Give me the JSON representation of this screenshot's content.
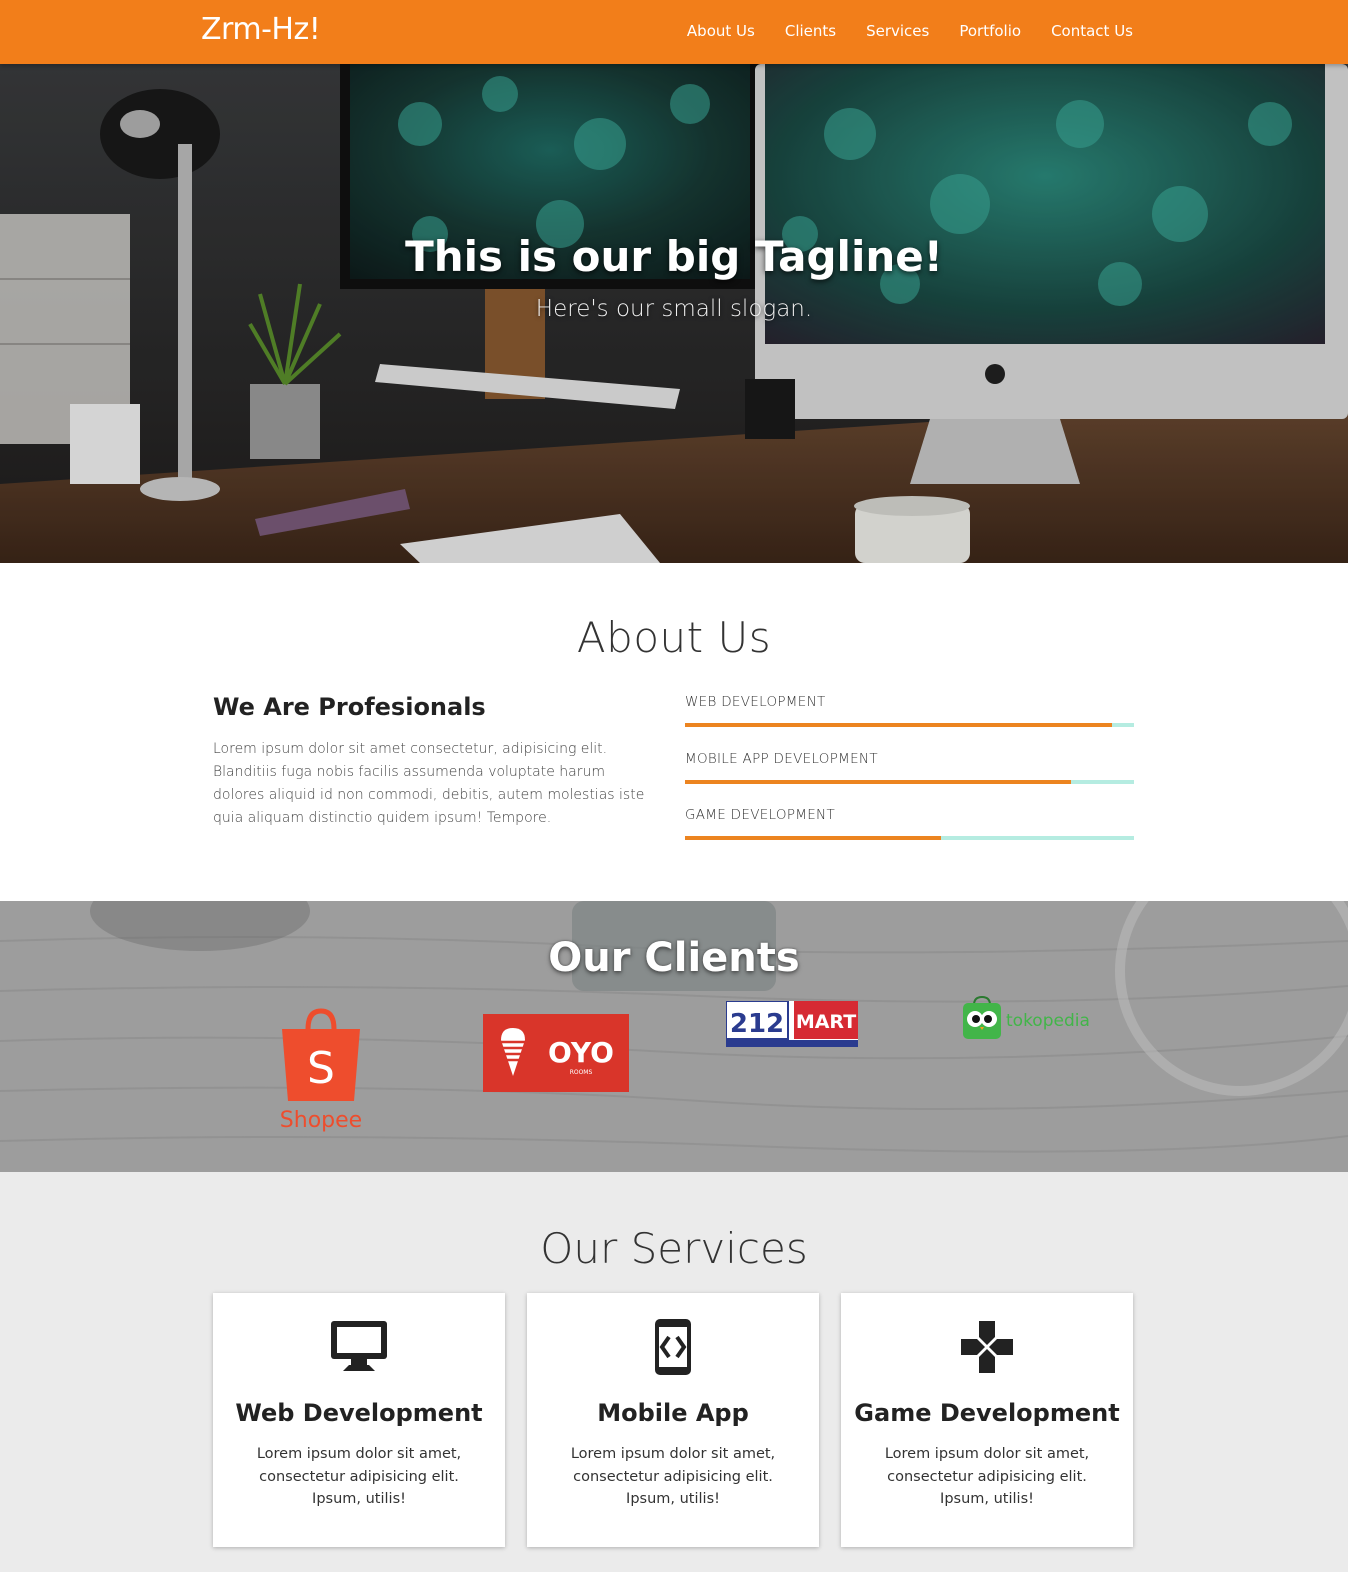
{
  "navbar": {
    "brand": "Zrm-Hz!",
    "links": [
      "About Us",
      "Clients",
      "Services",
      "Portfolio",
      "Contact Us"
    ],
    "color": "#f27e1a"
  },
  "hero": {
    "tagline": "This is our big Tagline!",
    "slogan": "Here's our small slogan."
  },
  "about": {
    "title": "About Us",
    "subtitle": "We Are Profesionals",
    "text": "Lorem ipsum dolor sit amet consectetur, adipisicing elit. Blanditiis fuga nobis facilis assumenda voluptate harum dolores aliquid id non commodi, debitis, autem molestias iste quia aliquam distinctio quidem ipsum! Tempore.",
    "skills": [
      {
        "label": "WEB DEVELOPMENT",
        "percent": 95
      },
      {
        "label": "MOBILE APP DEVELOPMENT",
        "percent": 86
      },
      {
        "label": "GAME DEVELOPMENT",
        "percent": 57
      }
    ],
    "bar_fill_color": "#ec8420",
    "bar_track_color": "#b5ece1"
  },
  "clients": {
    "title": "Our Clients",
    "logos": [
      {
        "name": "Shopee",
        "text": "Shopee",
        "mark": "S",
        "color": "#ee4d2d"
      },
      {
        "name": "OYO Rooms",
        "text": "OYO",
        "small": "ROOMS",
        "color": "#d9352a"
      },
      {
        "name": "212 Mart",
        "text": "MART",
        "mark": "212",
        "color": "#d62a33"
      },
      {
        "name": "Tokopedia",
        "text": "tokopedia",
        "color": "#42b549"
      }
    ]
  },
  "services": {
    "title": "Our Services",
    "cards": [
      {
        "icon": "desktop-icon",
        "title": "Web Development",
        "text": "Lorem ipsum dolor sit amet, consectetur adipisicing elit. Ipsum, utilis!"
      },
      {
        "icon": "mobile-code-icon",
        "title": "Mobile App",
        "text": "Lorem ipsum dolor sit amet, consectetur adipisicing elit. Ipsum, utilis!"
      },
      {
        "icon": "gamepad-icon",
        "title": "Game Development",
        "text": "Lorem ipsum dolor sit amet, consectetur adipisicing elit. Ipsum, utilis!"
      }
    ]
  }
}
